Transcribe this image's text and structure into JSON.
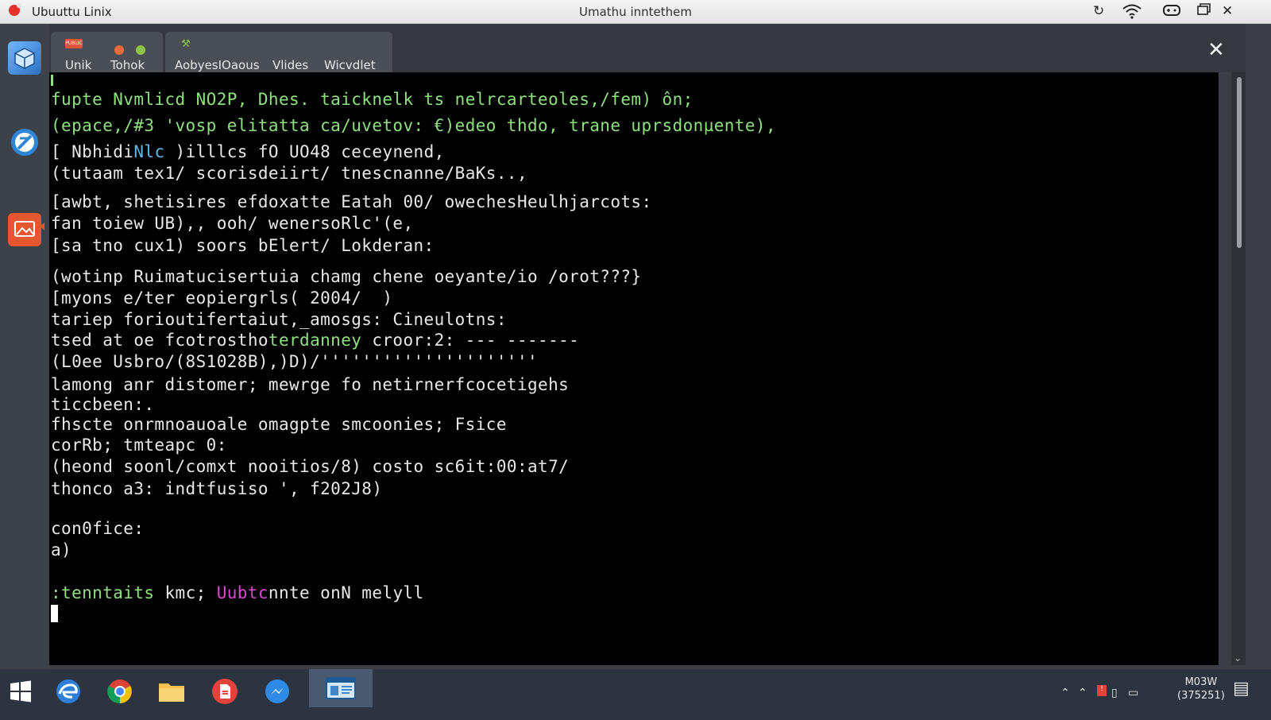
{
  "window": {
    "app_title": "Ubuuttu Linix",
    "title": "Umathu inntethem"
  },
  "tabs": [
    {
      "label": "Unik",
      "badge": "PUBLIC"
    },
    {
      "label": "Tohok"
    },
    {
      "label": "AobyesIOaous"
    },
    {
      "label": "Vlides"
    },
    {
      "label": "Wicvdlet"
    }
  ],
  "terminal": {
    "lines": [
      "fupte Nvmlicd NO2P, Dhes. taicknelk ts nelrcarteoles,/fem) ôn;",
      "(epace,/#3 'vosp elitatta ca/uvetov: €)edeo thdo, trane uprsdonµente),",
      "[ Nbhidi",
      "Nlc",
      " )illlcs fO UO48 ceceynend,",
      "(tutaam tex1/ scorisdeiirt/ tnescnanne/BaKs..,",
      "[awbt, shetisires efdoxatte Eatah 00/ owechesHeulhjarcots:",
      "fan toiew UB),, ooh/ wenersoRlc'(e,",
      "[sa tno cux1) soors bElert/ Lokderan:",
      "(wotinp Ruimatucisertuia chamg chene oeyante/io /orot???}",
      "[myons e/ter eopiergrls( 2004/  )",
      "tariep forioutifertaiut,_amosgs: Cineulotns:",
      "tsed at oe fcotrostho",
      "terdanney",
      " croor:2: --- -------",
      "(L0ee Usbro/(8S1028B),)D)/'''''''''''''''''''''",
      "lamong anr distomer; mewrge fo netirnerfcocetigehs",
      "ticcbeen:.",
      "fhscte onrmnoauoale omagpte smcoonies; Fsice",
      "corRb; tmteapc 0:",
      "(heond soonl/comxt nooitios/8) costo sc6it:00:at7/",
      "thonco a3: indtfusiso ', f202J8)",
      "con0fice:",
      "a)",
      ":tenntaits",
      " kmc; ",
      "Uubtc",
      "nnte onN melyll"
    ]
  },
  "clock": {
    "time": "M03W",
    "date": "(375251)"
  },
  "icons": {
    "dock": [
      "package-icon",
      "terminal-icon",
      "image-app-icon"
    ],
    "taskbar": [
      "windows-start-icon",
      "edge-browser-icon",
      "chrome-icon",
      "file-explorer-icon",
      "pdf-reader-icon",
      "messenger-icon",
      "terminal-window-icon"
    ]
  }
}
